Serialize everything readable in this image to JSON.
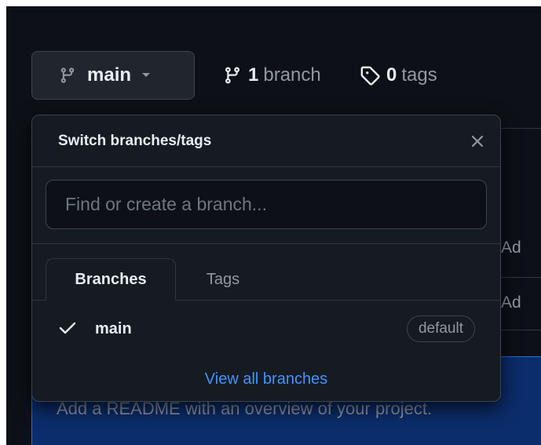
{
  "toolbar": {
    "branch_selector": {
      "label": "main",
      "icon": "git-branch-icon"
    },
    "branches_link": {
      "count": "1",
      "label": "branch",
      "icon": "git-branch-icon"
    },
    "tags_link": {
      "count": "0",
      "label": "tags",
      "icon": "tag-icon"
    }
  },
  "background": {
    "row1_text": "Ad",
    "row2_text": "Ad",
    "readme_text": "Add a README with an overview of your project."
  },
  "dropdown": {
    "title": "Switch branches/tags",
    "close_icon": "close-icon",
    "filter_placeholder": "Find or create a branch...",
    "tabs": [
      {
        "label": "Branches",
        "selected": true
      },
      {
        "label": "Tags",
        "selected": false
      }
    ],
    "branches": [
      {
        "name": "main",
        "badge": "default",
        "checked": true
      }
    ],
    "footer_link": "View all branches"
  },
  "colors": {
    "page_bg": "#0d1117",
    "overlay_bg": "#161b22",
    "border": "#30363d",
    "text": "#e6edf3",
    "muted": "#9198a1",
    "link": "#4493f8",
    "banner": "#0c2d6b"
  }
}
